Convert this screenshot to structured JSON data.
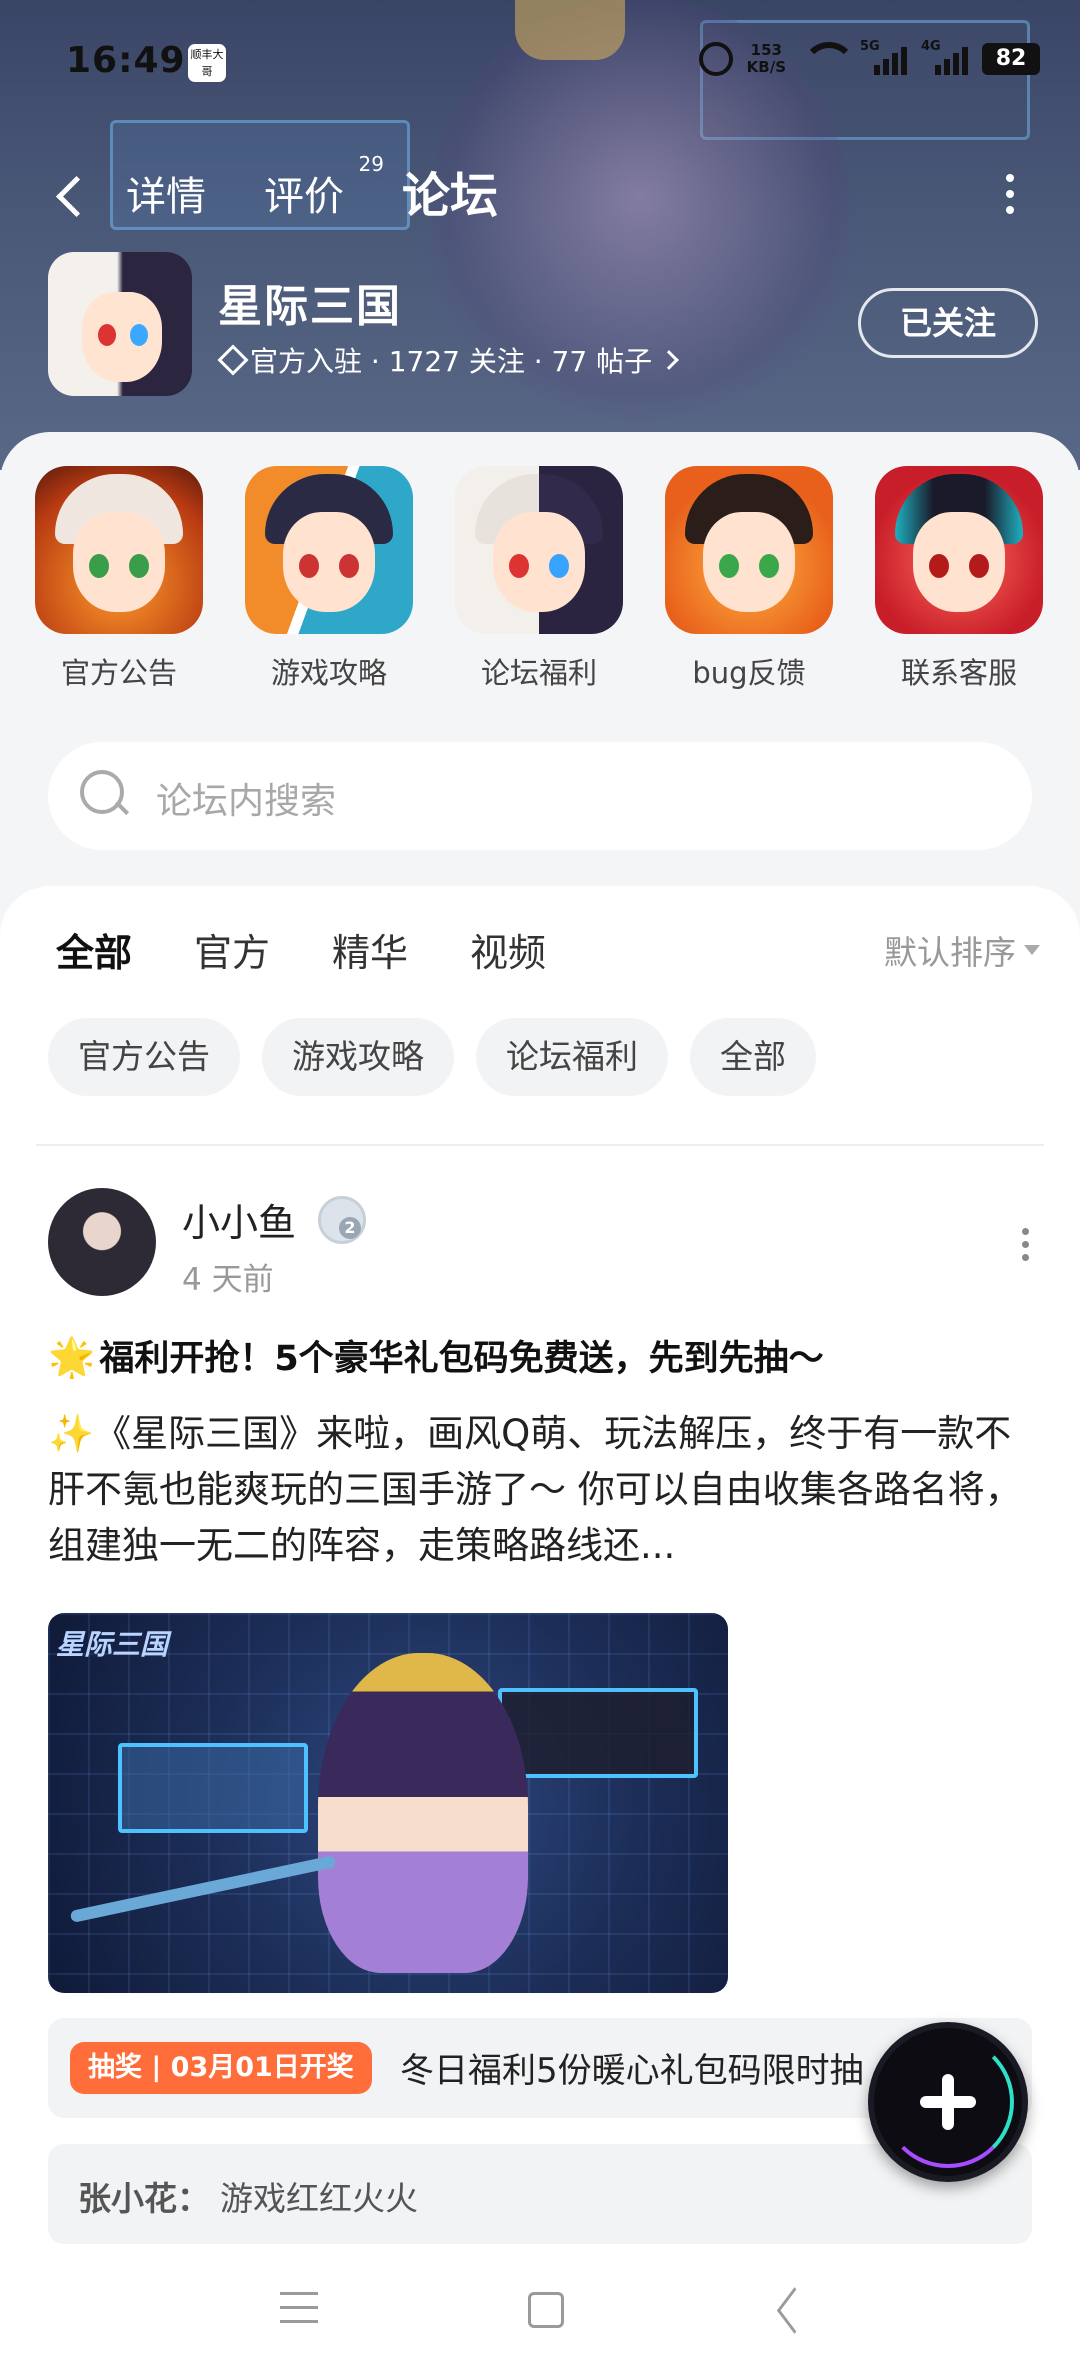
{
  "status_bar": {
    "time": "16:49",
    "app_badge": "顺丰大哥",
    "net_speed": "153",
    "net_unit": "KB/S",
    "net_5g": "5G",
    "net_4g": "4G",
    "battery": "82"
  },
  "top_nav": {
    "tabs": [
      "详情",
      "评价",
      "论坛"
    ],
    "review_count": "29",
    "active_tab": "论坛"
  },
  "game": {
    "name": "星际三国",
    "meta": "官方入驻 · 1727 关注 · 77 帖子",
    "follow_label": "已关注"
  },
  "categories": [
    {
      "label": "官方公告"
    },
    {
      "label": "游戏攻略"
    },
    {
      "label": "论坛福利"
    },
    {
      "label": "bug反馈"
    },
    {
      "label": "联系客服"
    }
  ],
  "search": {
    "placeholder": "论坛内搜索"
  },
  "feed": {
    "tabs": [
      "全部",
      "官方",
      "精华",
      "视频"
    ],
    "active_tab": "全部",
    "sort_label": "默认排序",
    "chips": [
      "官方公告",
      "游戏攻略",
      "论坛福利",
      "全部"
    ]
  },
  "post": {
    "author": "小小鱼",
    "level": "2",
    "time": "4 天前",
    "title_emoji": "🌟",
    "title": "福利开抢！5个豪华礼包码免费送，先到先抽～",
    "body_emoji": "✨",
    "body": "《星际三国》来啦，画风Q萌、玩法解压，终于有一款不肝不氪也能爽玩的三国手游了～ 你可以自由收集各路名将，组建独一无二的阵容，走策略路线还...",
    "image_logo": "星际三国",
    "lottery_badge": "抽奖 | 03月01日开奖",
    "lottery_text": "冬日福利5份暖心礼包码限时抽",
    "comment_user": "张小花：",
    "comment_text": "游戏红红火火"
  },
  "colors": {
    "accent": "#19d6c5",
    "lottery_badge": "#ff6d3a",
    "hero_bg": "#3a4566"
  }
}
